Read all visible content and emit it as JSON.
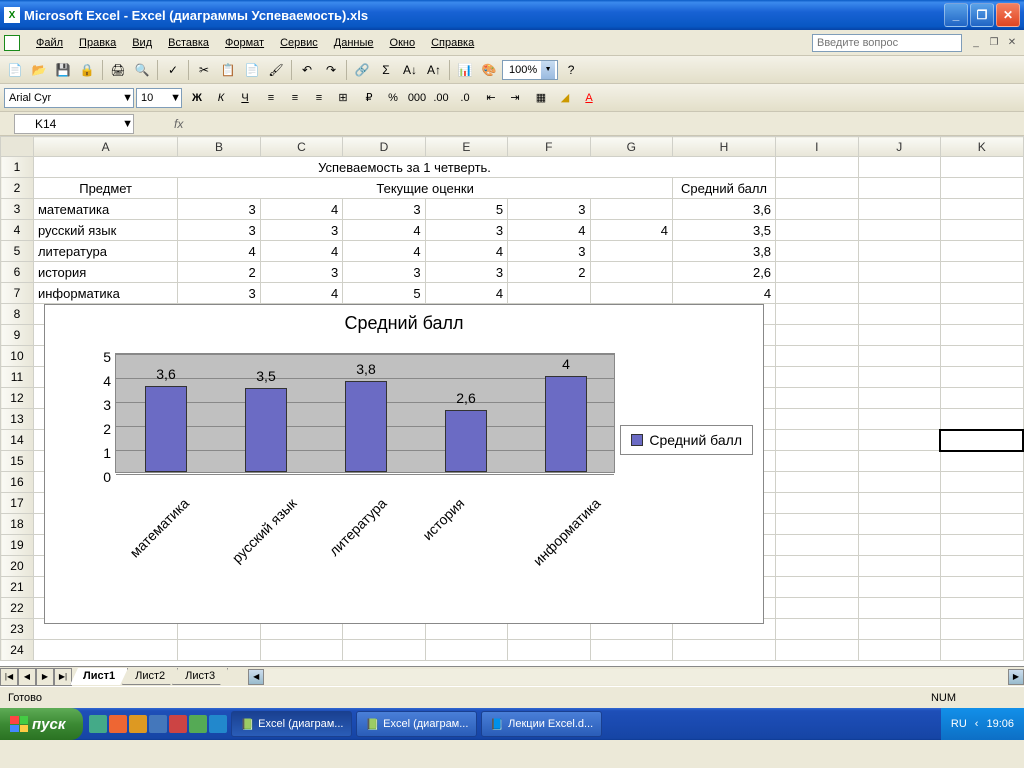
{
  "titlebar": {
    "title": "Microsoft Excel - Excel (диаграммы Успеваемость).xls"
  },
  "menu": {
    "file": "Файл",
    "edit": "Правка",
    "view": "Вид",
    "insert": "Вставка",
    "format": "Формат",
    "tools": "Сервис",
    "data": "Данные",
    "window": "Окно",
    "help": "Справка",
    "question_placeholder": "Введите вопрос"
  },
  "toolbar": {
    "zoom": "100%"
  },
  "format_tb": {
    "font": "Arial Cyr",
    "size": "10"
  },
  "formula": {
    "cell_ref": "K14",
    "fx": "fx"
  },
  "columns": [
    "A",
    "B",
    "C",
    "D",
    "E",
    "F",
    "G",
    "H",
    "I",
    "J",
    "K"
  ],
  "rows": [
    "1",
    "2",
    "3",
    "4",
    "5",
    "6",
    "7",
    "8",
    "9",
    "10",
    "11",
    "12",
    "13",
    "14",
    "15",
    "16",
    "17",
    "18",
    "19",
    "20",
    "21",
    "22",
    "23",
    "24"
  ],
  "cells": {
    "title": "Успеваемость за 1 четверть.",
    "hdr_subject": "Предмет",
    "hdr_grades": "Текущие оценки",
    "hdr_avg": "Средний балл",
    "data": [
      {
        "subject": "математика",
        "g": [
          "3",
          "4",
          "3",
          "5",
          "3",
          ""
        ],
        "avg": "3,6"
      },
      {
        "subject": "русский язык",
        "g": [
          "3",
          "3",
          "4",
          "3",
          "4",
          "4"
        ],
        "avg": "3,5"
      },
      {
        "subject": "литература",
        "g": [
          "4",
          "4",
          "4",
          "4",
          "3",
          ""
        ],
        "avg": "3,8"
      },
      {
        "subject": "история",
        "g": [
          "2",
          "3",
          "3",
          "3",
          "2",
          ""
        ],
        "avg": "2,6"
      },
      {
        "subject": "информатика",
        "g": [
          "3",
          "4",
          "5",
          "4",
          "",
          ""
        ],
        "avg": "4"
      }
    ]
  },
  "chart_data": {
    "type": "bar",
    "title": "Средний балл",
    "categories": [
      "математика",
      "русский язык",
      "литература",
      "история",
      "информатика"
    ],
    "values": [
      3.6,
      3.5,
      3.8,
      2.6,
      4.0
    ],
    "value_labels": [
      "3,6",
      "3,5",
      "3,8",
      "2,6",
      "4"
    ],
    "legend": "Средний балл",
    "ylim": [
      0,
      5
    ],
    "yticks": [
      0,
      1,
      2,
      3,
      4,
      5
    ]
  },
  "sheets": {
    "s1": "Лист1",
    "s2": "Лист2",
    "s3": "Лист3"
  },
  "status": {
    "ready": "Готово",
    "num": "NUM"
  },
  "taskbar": {
    "start": "пуск",
    "t1": "Excel (диаграм...",
    "t2": "Excel (диаграм...",
    "t3": "Лекции Excel.d...",
    "lang": "RU",
    "clock": "19:06"
  }
}
